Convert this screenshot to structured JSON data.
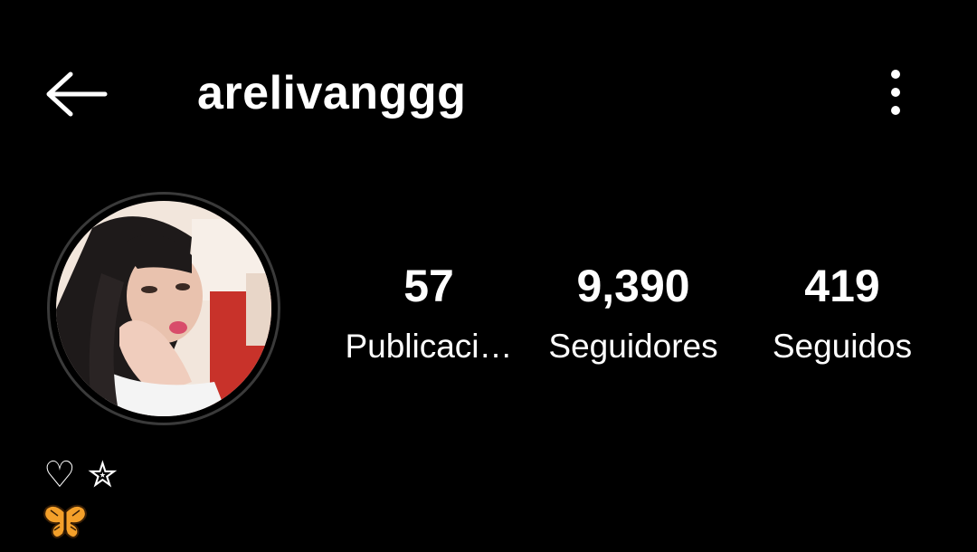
{
  "header": {
    "username": "arelivanggg",
    "back_icon": "arrow-left-icon",
    "menu_icon": "more-vertical-icon"
  },
  "profile": {
    "avatar_icon": "profile-photo"
  },
  "stats": [
    {
      "value": "57",
      "label": "Publicaci…"
    },
    {
      "value": "9,390",
      "label": "Seguidores"
    },
    {
      "value": "419",
      "label": "Seguidos"
    }
  ],
  "bio": {
    "line1": "♡ ✮",
    "line2_icon": "butterfly-emoji"
  },
  "colors": {
    "background": "#000000",
    "text": "#ffffff",
    "avatar_ring": "#3a3a3a",
    "butterfly": "#f4a02a"
  }
}
